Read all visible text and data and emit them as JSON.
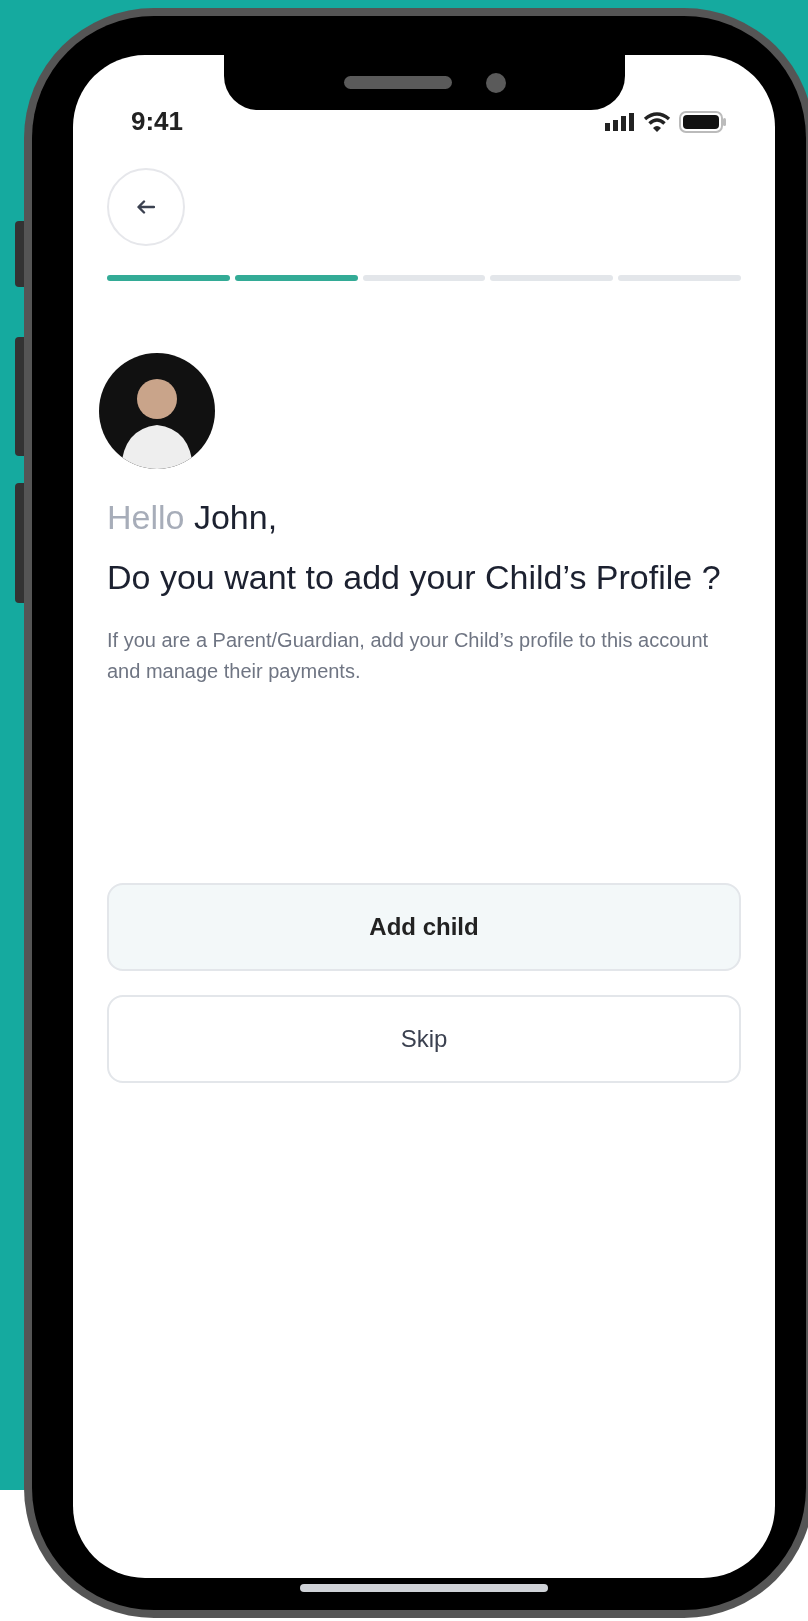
{
  "status_bar": {
    "time": "9:41"
  },
  "progress_steps": [
    {
      "done": true
    },
    {
      "done": true
    },
    {
      "done": false
    },
    {
      "done": false
    },
    {
      "done": false
    }
  ],
  "greeting": {
    "salutation": "Hello",
    "name": "John,"
  },
  "title": "Do you want to add your Child’s Profile ?",
  "description": "If you are a Parent/Guardian, add your Child’s profile to this account and manage their payments.",
  "buttons": [
    {
      "label": "Add child",
      "kind": "primary"
    },
    {
      "label": "Skip",
      "kind": "secondary"
    }
  ]
}
